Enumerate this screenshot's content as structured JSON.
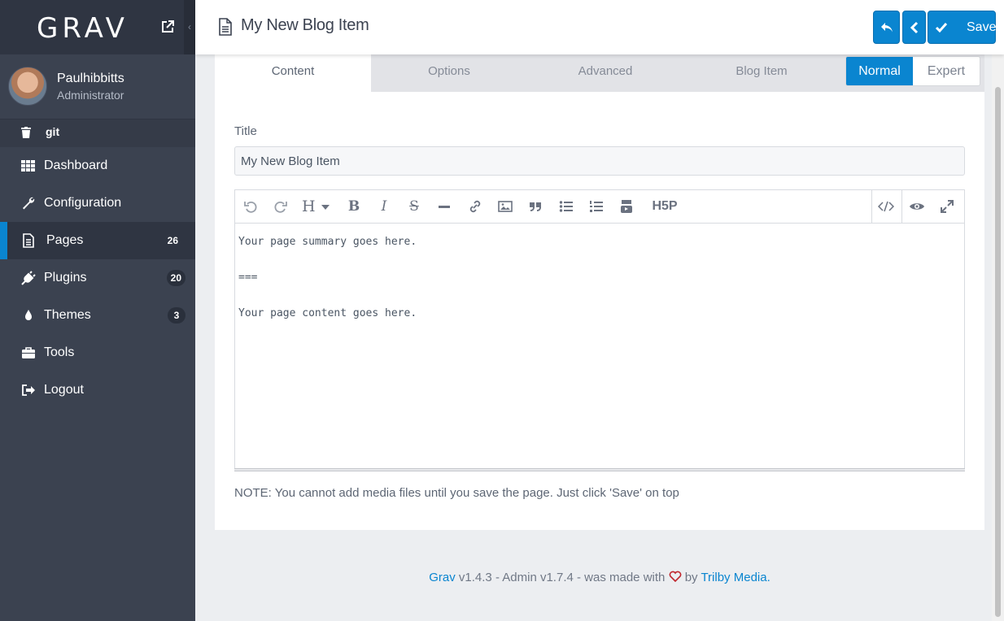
{
  "sidebar": {
    "logo": "GRAV",
    "user": {
      "name": "Paulhibbitts",
      "role": "Administrator"
    },
    "git_label": "git",
    "items": [
      {
        "label": "Dashboard",
        "icon": "grid-icon",
        "badge": ""
      },
      {
        "label": "Configuration",
        "icon": "wrench-icon",
        "badge": ""
      },
      {
        "label": "Pages",
        "icon": "file-icon",
        "badge": "26"
      },
      {
        "label": "Plugins",
        "icon": "plug-icon",
        "badge": "20"
      },
      {
        "label": "Themes",
        "icon": "drop-icon",
        "badge": "3"
      },
      {
        "label": "Tools",
        "icon": "briefcase-icon",
        "badge": ""
      },
      {
        "label": "Logout",
        "icon": "sign-out-icon",
        "badge": ""
      }
    ]
  },
  "header": {
    "title": "My New Blog Item",
    "save_label": "Save"
  },
  "tabs": [
    "Content",
    "Options",
    "Advanced",
    "Blog Item"
  ],
  "mode": {
    "normal": "Normal",
    "expert": "Expert"
  },
  "form": {
    "title_label": "Title",
    "title_value": "My New Blog Item",
    "content_lines": [
      "Your page summary goes here.",
      "",
      "===",
      "",
      "Your page content goes here."
    ],
    "h5p_label": "H5P",
    "heading_label": "H",
    "note": "NOTE: You cannot add media files until you save the page. Just click 'Save' on top"
  },
  "footer": {
    "grav": "Grav",
    "middle": " v1.4.3 - Admin v1.7.4 - was made with ",
    "by": " by ",
    "trilby": "Trilby Media."
  },
  "colors": {
    "accent": "#0a85d0",
    "sidebar": "#3b4250",
    "heart": "#c0262d"
  }
}
